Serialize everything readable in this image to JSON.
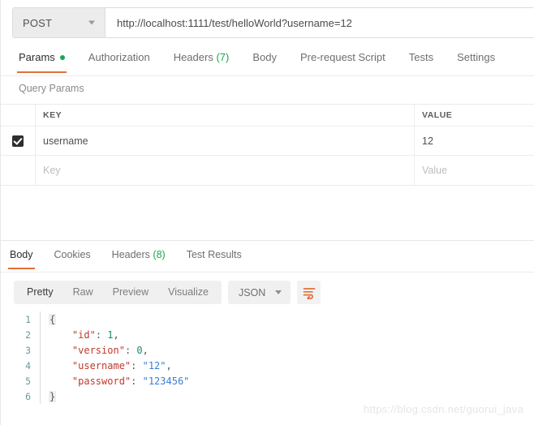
{
  "request": {
    "method": "POST",
    "url": "http://localhost:1111/test/helloWorld?username=12",
    "tabs": [
      {
        "label": "Params",
        "active": true,
        "indicator": "dot"
      },
      {
        "label": "Authorization",
        "active": false
      },
      {
        "label": "Headers",
        "count": "(7)",
        "active": false
      },
      {
        "label": "Body",
        "active": false
      },
      {
        "label": "Pre-request Script",
        "active": false
      },
      {
        "label": "Tests",
        "active": false
      },
      {
        "label": "Settings",
        "active": false
      }
    ]
  },
  "query_params": {
    "title": "Query Params",
    "columns": {
      "key": "KEY",
      "value": "VALUE"
    },
    "rows": [
      {
        "checked": true,
        "key": "username",
        "value": "12"
      },
      {
        "checked": false,
        "key_placeholder": "Key",
        "value_placeholder": "Value"
      }
    ]
  },
  "response": {
    "tabs": [
      {
        "label": "Body",
        "active": true
      },
      {
        "label": "Cookies",
        "active": false
      },
      {
        "label": "Headers",
        "count": "(8)",
        "active": false
      },
      {
        "label": "Test Results",
        "active": false
      }
    ],
    "format_buttons": [
      {
        "label": "Pretty",
        "active": true
      },
      {
        "label": "Raw",
        "active": false
      },
      {
        "label": "Preview",
        "active": false
      },
      {
        "label": "Visualize",
        "active": false
      }
    ],
    "language": "JSON",
    "wrap_icon": "wrap-lines-icon",
    "body_lines": [
      {
        "num": "1",
        "tokens": [
          {
            "t": "brace",
            "v": "{"
          }
        ]
      },
      {
        "num": "2",
        "tokens": [
          {
            "t": "pun",
            "v": "    "
          },
          {
            "t": "key",
            "v": "\"id\""
          },
          {
            "t": "pun",
            "v": ": "
          },
          {
            "t": "num",
            "v": "1"
          },
          {
            "t": "pun",
            "v": ","
          }
        ]
      },
      {
        "num": "3",
        "tokens": [
          {
            "t": "pun",
            "v": "    "
          },
          {
            "t": "key",
            "v": "\"version\""
          },
          {
            "t": "pun",
            "v": ": "
          },
          {
            "t": "num",
            "v": "0"
          },
          {
            "t": "pun",
            "v": ","
          }
        ]
      },
      {
        "num": "4",
        "tokens": [
          {
            "t": "pun",
            "v": "    "
          },
          {
            "t": "key",
            "v": "\"username\""
          },
          {
            "t": "pun",
            "v": ": "
          },
          {
            "t": "str",
            "v": "\"12\""
          },
          {
            "t": "pun",
            "v": ","
          }
        ]
      },
      {
        "num": "5",
        "tokens": [
          {
            "t": "pun",
            "v": "    "
          },
          {
            "t": "key",
            "v": "\"password\""
          },
          {
            "t": "pun",
            "v": ": "
          },
          {
            "t": "str",
            "v": "\"123456\""
          }
        ]
      },
      {
        "num": "6",
        "tokens": [
          {
            "t": "brace",
            "v": "}"
          }
        ]
      }
    ],
    "parsed_body": {
      "id": 1,
      "version": 0,
      "username": "12",
      "password": "123456"
    }
  },
  "watermark": "https://blog.csdn.net/guorui_java",
  "colors": {
    "accent_orange": "#e2703a",
    "indicator_green": "#15a84c",
    "json_key": "#c0392b",
    "json_string": "#3b7dd8",
    "json_number": "#1a8a6c",
    "line_number": "#6b9a9a"
  }
}
